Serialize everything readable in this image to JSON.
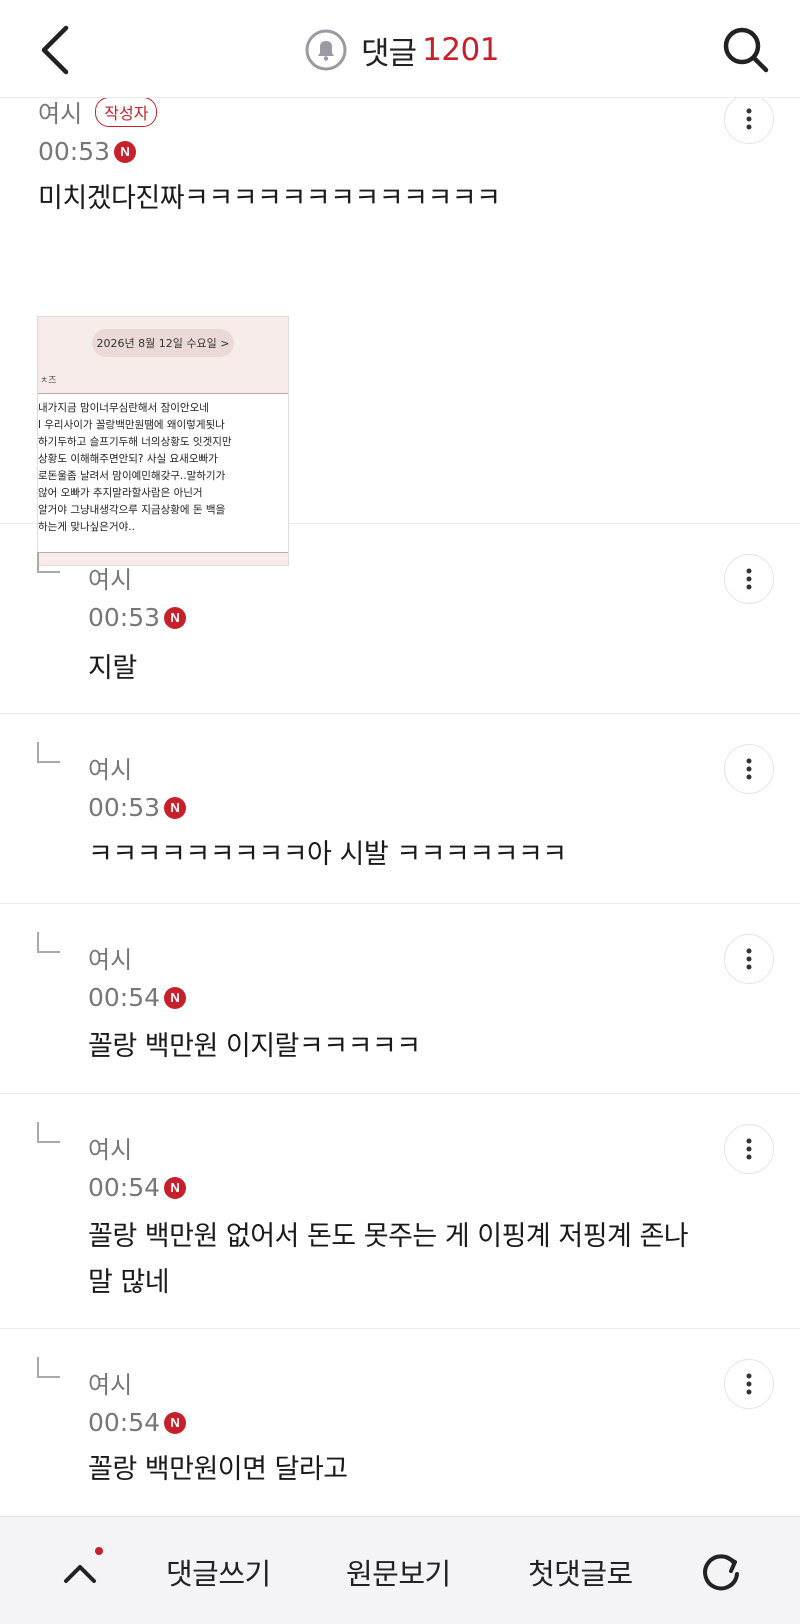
{
  "header": {
    "back_icon": "chevron-left-icon",
    "bell_icon": "bell-icon",
    "title": "댓글",
    "count": "1201",
    "search_icon": "search-icon"
  },
  "comments": [
    {
      "author": "여시",
      "badge": "작성자",
      "time": "00:53",
      "new_badge": "N",
      "text": "미치겠다진짜ㅋㅋㅋㅋㅋㅋㅋㅋㅋㅋㅋㅋㅋ",
      "image": {
        "date_pill": "2026년 8월 12일 수요일  >",
        "side_label": "ㅊ즈",
        "lines": [
          "내가지금 맘이너무심란해서 잠이안오네",
          "l 우리사이가 꼴랑백만원땜에 왜이렇게됫나",
          "하기두하고 슬프기두해 너의상황도 잇겟지만",
          "상황도 이해해주면안되? 사실 요새오빠가",
          "로돈울좀 날려서 맘이예민해갖구..말하기가",
          "않어 오빠가 추지말라할사람은 아닌거",
          "알거야 그냥내생각으루 지금상황에 돈 백을",
          "하는게 맞나싶은거야.."
        ]
      }
    },
    {
      "author": "여시",
      "time": "00:53",
      "new_badge": "N",
      "text": "지랄"
    },
    {
      "author": "여시",
      "time": "00:53",
      "new_badge": "N",
      "text": "ㅋㅋㅋㅋㅋㅋㅋㅋㅋ아 시발 ㅋㅋㅋㅋㅋㅋㅋ"
    },
    {
      "author": "여시",
      "time": "00:54",
      "new_badge": "N",
      "text": "꼴랑 백만원 이지랄ㅋㅋㅋㅋㅋ"
    },
    {
      "author": "여시",
      "time": "00:54",
      "new_badge": "N",
      "text_line1": "꼴랑 백만원 없어서 돈도 못주는 게 이핑계 저핑계 존나",
      "text_line2": "말 많네"
    },
    {
      "author": "여시",
      "time": "00:54",
      "new_badge": "N",
      "text": "꼴랑 백만원이면 달라고"
    }
  ],
  "bottom_bar": {
    "up_icon": "chevron-up-icon",
    "write": "댓글쓰기",
    "original": "원문보기",
    "first": "첫댓글로",
    "refresh_icon": "refresh-icon"
  }
}
